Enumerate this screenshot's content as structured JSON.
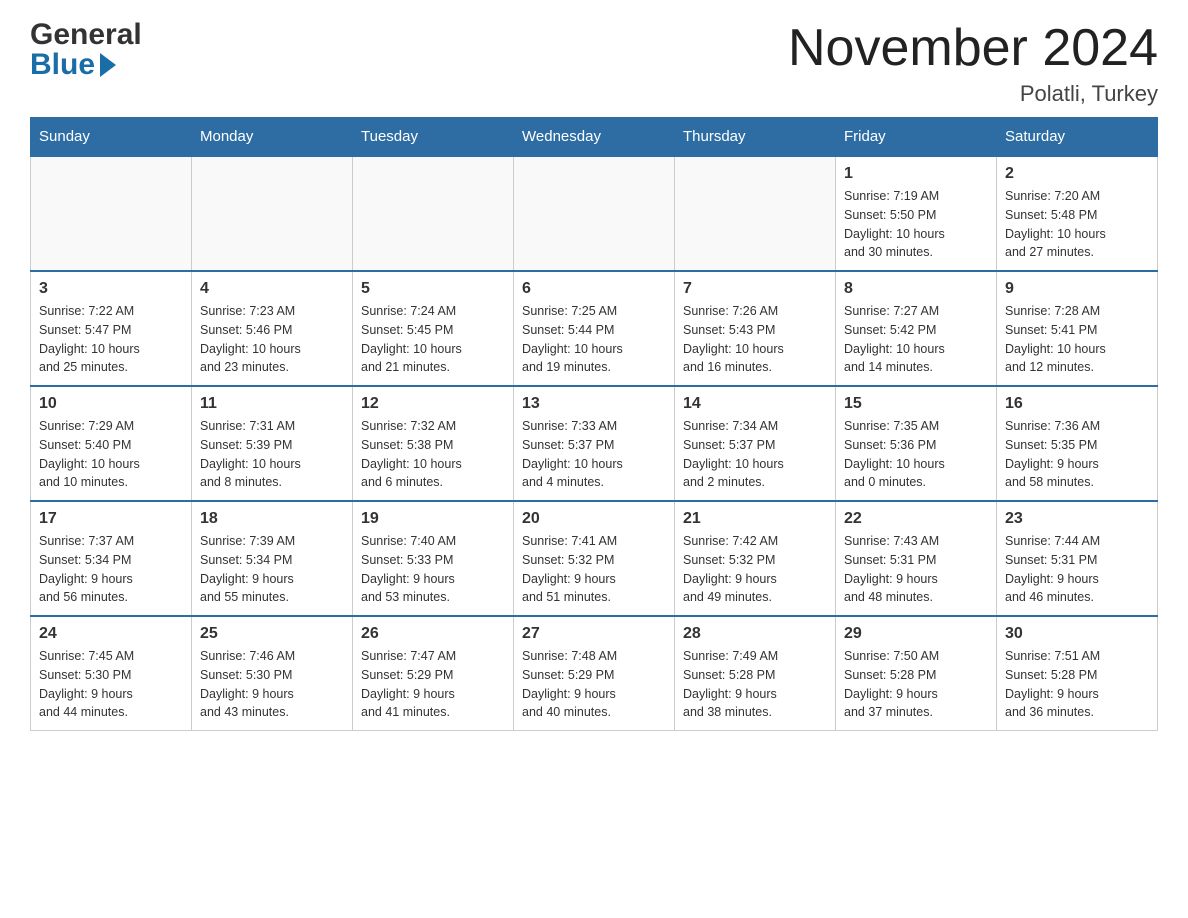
{
  "header": {
    "logo_general": "General",
    "logo_blue": "Blue",
    "month_title": "November 2024",
    "location": "Polatli, Turkey"
  },
  "calendar": {
    "days_of_week": [
      "Sunday",
      "Monday",
      "Tuesday",
      "Wednesday",
      "Thursday",
      "Friday",
      "Saturday"
    ],
    "weeks": [
      [
        {
          "day": "",
          "info": ""
        },
        {
          "day": "",
          "info": ""
        },
        {
          "day": "",
          "info": ""
        },
        {
          "day": "",
          "info": ""
        },
        {
          "day": "",
          "info": ""
        },
        {
          "day": "1",
          "info": "Sunrise: 7:19 AM\nSunset: 5:50 PM\nDaylight: 10 hours\nand 30 minutes."
        },
        {
          "day": "2",
          "info": "Sunrise: 7:20 AM\nSunset: 5:48 PM\nDaylight: 10 hours\nand 27 minutes."
        }
      ],
      [
        {
          "day": "3",
          "info": "Sunrise: 7:22 AM\nSunset: 5:47 PM\nDaylight: 10 hours\nand 25 minutes."
        },
        {
          "day": "4",
          "info": "Sunrise: 7:23 AM\nSunset: 5:46 PM\nDaylight: 10 hours\nand 23 minutes."
        },
        {
          "day": "5",
          "info": "Sunrise: 7:24 AM\nSunset: 5:45 PM\nDaylight: 10 hours\nand 21 minutes."
        },
        {
          "day": "6",
          "info": "Sunrise: 7:25 AM\nSunset: 5:44 PM\nDaylight: 10 hours\nand 19 minutes."
        },
        {
          "day": "7",
          "info": "Sunrise: 7:26 AM\nSunset: 5:43 PM\nDaylight: 10 hours\nand 16 minutes."
        },
        {
          "day": "8",
          "info": "Sunrise: 7:27 AM\nSunset: 5:42 PM\nDaylight: 10 hours\nand 14 minutes."
        },
        {
          "day": "9",
          "info": "Sunrise: 7:28 AM\nSunset: 5:41 PM\nDaylight: 10 hours\nand 12 minutes."
        }
      ],
      [
        {
          "day": "10",
          "info": "Sunrise: 7:29 AM\nSunset: 5:40 PM\nDaylight: 10 hours\nand 10 minutes."
        },
        {
          "day": "11",
          "info": "Sunrise: 7:31 AM\nSunset: 5:39 PM\nDaylight: 10 hours\nand 8 minutes."
        },
        {
          "day": "12",
          "info": "Sunrise: 7:32 AM\nSunset: 5:38 PM\nDaylight: 10 hours\nand 6 minutes."
        },
        {
          "day": "13",
          "info": "Sunrise: 7:33 AM\nSunset: 5:37 PM\nDaylight: 10 hours\nand 4 minutes."
        },
        {
          "day": "14",
          "info": "Sunrise: 7:34 AM\nSunset: 5:37 PM\nDaylight: 10 hours\nand 2 minutes."
        },
        {
          "day": "15",
          "info": "Sunrise: 7:35 AM\nSunset: 5:36 PM\nDaylight: 10 hours\nand 0 minutes."
        },
        {
          "day": "16",
          "info": "Sunrise: 7:36 AM\nSunset: 5:35 PM\nDaylight: 9 hours\nand 58 minutes."
        }
      ],
      [
        {
          "day": "17",
          "info": "Sunrise: 7:37 AM\nSunset: 5:34 PM\nDaylight: 9 hours\nand 56 minutes."
        },
        {
          "day": "18",
          "info": "Sunrise: 7:39 AM\nSunset: 5:34 PM\nDaylight: 9 hours\nand 55 minutes."
        },
        {
          "day": "19",
          "info": "Sunrise: 7:40 AM\nSunset: 5:33 PM\nDaylight: 9 hours\nand 53 minutes."
        },
        {
          "day": "20",
          "info": "Sunrise: 7:41 AM\nSunset: 5:32 PM\nDaylight: 9 hours\nand 51 minutes."
        },
        {
          "day": "21",
          "info": "Sunrise: 7:42 AM\nSunset: 5:32 PM\nDaylight: 9 hours\nand 49 minutes."
        },
        {
          "day": "22",
          "info": "Sunrise: 7:43 AM\nSunset: 5:31 PM\nDaylight: 9 hours\nand 48 minutes."
        },
        {
          "day": "23",
          "info": "Sunrise: 7:44 AM\nSunset: 5:31 PM\nDaylight: 9 hours\nand 46 minutes."
        }
      ],
      [
        {
          "day": "24",
          "info": "Sunrise: 7:45 AM\nSunset: 5:30 PM\nDaylight: 9 hours\nand 44 minutes."
        },
        {
          "day": "25",
          "info": "Sunrise: 7:46 AM\nSunset: 5:30 PM\nDaylight: 9 hours\nand 43 minutes."
        },
        {
          "day": "26",
          "info": "Sunrise: 7:47 AM\nSunset: 5:29 PM\nDaylight: 9 hours\nand 41 minutes."
        },
        {
          "day": "27",
          "info": "Sunrise: 7:48 AM\nSunset: 5:29 PM\nDaylight: 9 hours\nand 40 minutes."
        },
        {
          "day": "28",
          "info": "Sunrise: 7:49 AM\nSunset: 5:28 PM\nDaylight: 9 hours\nand 38 minutes."
        },
        {
          "day": "29",
          "info": "Sunrise: 7:50 AM\nSunset: 5:28 PM\nDaylight: 9 hours\nand 37 minutes."
        },
        {
          "day": "30",
          "info": "Sunrise: 7:51 AM\nSunset: 5:28 PM\nDaylight: 9 hours\nand 36 minutes."
        }
      ]
    ]
  }
}
